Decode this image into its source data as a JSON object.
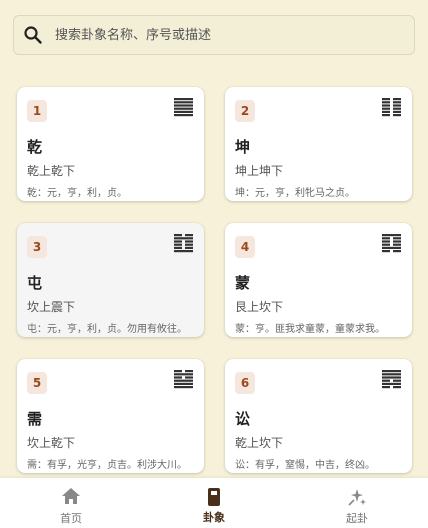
{
  "search": {
    "placeholder": "搜索卦象名称、序号或描述"
  },
  "cards": [
    {
      "num": "1",
      "name": "乾",
      "sub": "乾上乾下",
      "desc": "乾：元，亨，利，贞。",
      "lines": [
        1,
        1,
        1,
        1,
        1,
        1
      ],
      "active": false
    },
    {
      "num": "2",
      "name": "坤",
      "sub": "坤上坤下",
      "desc": "坤：元，亨，利牝马之贞。",
      "lines": [
        0,
        0,
        0,
        0,
        0,
        0
      ],
      "active": false
    },
    {
      "num": "3",
      "name": "屯",
      "sub": "坎上震下",
      "desc": "屯：元，亨，利，贞。勿用有攸往。",
      "lines": [
        0,
        1,
        0,
        0,
        0,
        1
      ],
      "active": true
    },
    {
      "num": "4",
      "name": "蒙",
      "sub": "艮上坎下",
      "desc": "蒙：亨。匪我求童蒙，童蒙求我。",
      "lines": [
        1,
        0,
        0,
        0,
        1,
        0
      ],
      "active": false
    },
    {
      "num": "5",
      "name": "需",
      "sub": "坎上乾下",
      "desc": "需：有孚，光亨，贞吉。利涉大川。",
      "lines": [
        0,
        1,
        0,
        1,
        1,
        1
      ],
      "active": false
    },
    {
      "num": "6",
      "name": "讼",
      "sub": "乾上坎下",
      "desc": "讼：有孚，窒惕，中吉，终凶。",
      "lines": [
        1,
        1,
        1,
        0,
        1,
        0
      ],
      "active": false
    }
  ],
  "nav": [
    {
      "label": "首页",
      "icon": "home-icon"
    },
    {
      "label": "卦象",
      "icon": "book-icon"
    },
    {
      "label": "起卦",
      "icon": "sparkle-icon"
    }
  ],
  "colors": {
    "background": "#f6f1d8",
    "accent": "#4a2e1a",
    "badge_bg": "#f6e7de",
    "badge_text": "#9a4a1c"
  }
}
